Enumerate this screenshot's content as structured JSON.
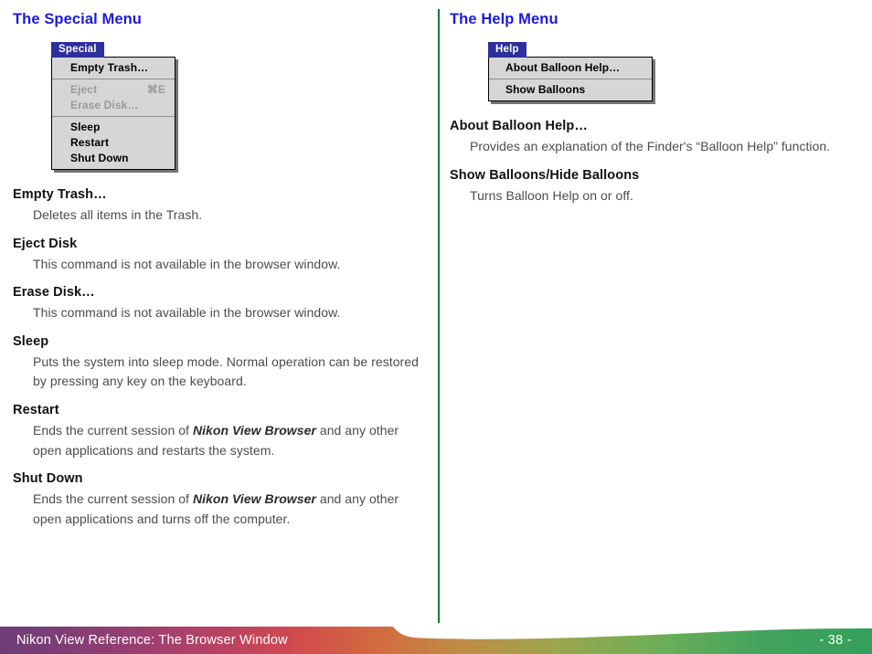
{
  "document": {
    "left_column": {
      "heading": "The Special Menu",
      "menu": {
        "title": "Special",
        "groups": [
          {
            "items": [
              {
                "label": "Empty Trash…",
                "shortcut": "",
                "disabled": false
              }
            ]
          },
          {
            "items": [
              {
                "label": "Eject",
                "shortcut": "⌘E",
                "disabled": true
              },
              {
                "label": "Erase Disk…",
                "shortcut": "",
                "disabled": true
              }
            ]
          },
          {
            "items": [
              {
                "label": "Sleep",
                "shortcut": "",
                "disabled": false
              },
              {
                "label": "Restart",
                "shortcut": "",
                "disabled": false
              },
              {
                "label": "Shut Down",
                "shortcut": "",
                "disabled": false
              }
            ]
          }
        ]
      },
      "definitions": [
        {
          "term": "Empty Trash…",
          "desc_pre": "Deletes all items in the Trash.",
          "desc_em": "",
          "desc_post": ""
        },
        {
          "term": "Eject Disk",
          "desc_pre": "This command is not available in the browser window.",
          "desc_em": "",
          "desc_post": ""
        },
        {
          "term": "Erase Disk…",
          "desc_pre": "This command is not available in the browser window.",
          "desc_em": "",
          "desc_post": ""
        },
        {
          "term": "Sleep",
          "desc_pre": "Puts the system into sleep mode.  Normal operation can be restored by pressing any key on the keyboard.",
          "desc_em": "",
          "desc_post": ""
        },
        {
          "term": "Restart",
          "desc_pre": "Ends the current session of ",
          "desc_em": "Nikon View Browser",
          "desc_post": " and any other open applications and restarts the system."
        },
        {
          "term": "Shut Down",
          "desc_pre": "Ends the current session of ",
          "desc_em": "Nikon View Browser",
          "desc_post": " and any other open applications and turns off the computer."
        }
      ]
    },
    "right_column": {
      "heading": "The Help Menu",
      "menu": {
        "title": "Help",
        "groups": [
          {
            "items": [
              {
                "label": "About Balloon Help…",
                "shortcut": "",
                "disabled": false
              }
            ]
          },
          {
            "items": [
              {
                "label": "Show Balloons",
                "shortcut": "",
                "disabled": false
              }
            ]
          }
        ]
      },
      "definitions": [
        {
          "term": "About Balloon Help…",
          "desc_pre": "Provides an explanation of the Finder's “Balloon Help” function.",
          "desc_em": "",
          "desc_post": ""
        },
        {
          "term": "Show Balloons/Hide Balloons",
          "desc_pre": "Turns Balloon Help on or off.",
          "desc_em": "",
          "desc_post": ""
        }
      ]
    },
    "footer": {
      "title": "Nikon View Reference:  The Browser Window",
      "page_number": "- 38 -"
    },
    "colors": {
      "heading_blue": "#1a1ae0",
      "divider_green": "#0a7a38",
      "menu_title_bg": "#2e2e9c",
      "menu_body_bg": "#d6d6d6",
      "menu_disabled_text": "#9a9a9a",
      "body_text": "#4c4c4c",
      "footer_start": "#6e3d77",
      "footer_mid": "#d14a4e",
      "footer_end": "#34a05b"
    }
  }
}
